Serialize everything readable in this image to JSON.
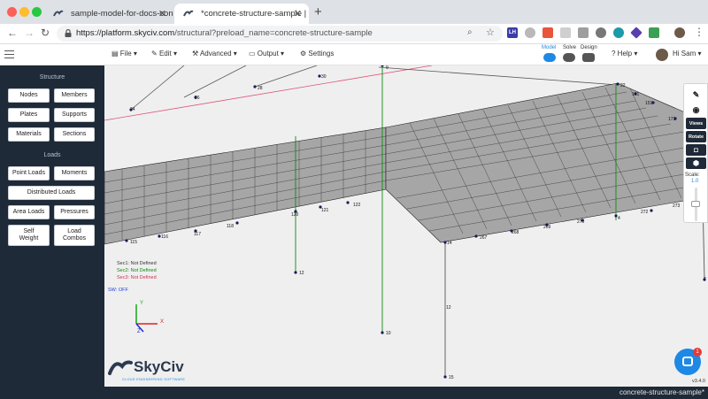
{
  "browser": {
    "tabs": [
      {
        "title": "sample-model-for-docs-concre",
        "active": false
      },
      {
        "title": "*concrete-structure-sample | Sk",
        "active": true
      }
    ],
    "url_host": "https://platform.skyciv.com",
    "url_path": "/structural?preload_name=concrete-structure-sample"
  },
  "toolbar": {
    "menus": [
      "File",
      "Edit",
      "Advanced",
      "Output",
      "Settings"
    ],
    "modes": [
      "Model",
      "Solve",
      "Design"
    ],
    "help": "Help",
    "user": "Hi Sam"
  },
  "sidebar": {
    "structure_heading": "Structure",
    "structure_buttons": [
      "Nodes",
      "Members",
      "Plates",
      "Supports",
      "Materials",
      "Sections"
    ],
    "loads_heading": "Loads",
    "load_buttons": [
      "Point Loads",
      "Moments",
      "Distributed Loads",
      "Area Loads",
      "Pressures",
      "Self Weight",
      "Load Combos"
    ]
  },
  "viewport": {
    "sections_legend": [
      {
        "label": "Sec1: Not Defined",
        "color": "#333333"
      },
      {
        "label": "Sec2: Not Defined",
        "color": "#118811"
      },
      {
        "label": "Sec3: Not Defined",
        "color": "#cc3355"
      }
    ],
    "sw_status": "SW: OFF",
    "axes": [
      "Y",
      "X",
      "Z"
    ],
    "brand": "SkyCiv",
    "brand_tagline": "CLOUD ENGINEERING SOFTWARE",
    "version": "v3.4.0",
    "scale_label": "Scale:",
    "scale_value": "1.0",
    "panel_buttons": [
      "Views",
      "Rotate"
    ],
    "chat_badge": "1",
    "node_labels": [
      {
        "id": "9"
      },
      {
        "id": "30"
      },
      {
        "id": "28"
      },
      {
        "id": "26"
      },
      {
        "id": "24"
      },
      {
        "id": "22"
      },
      {
        "id": "141"
      },
      {
        "id": "151"
      },
      {
        "id": "171"
      },
      {
        "id": "120"
      },
      {
        "id": "121"
      },
      {
        "id": "122"
      },
      {
        "id": "118"
      },
      {
        "id": "117"
      },
      {
        "id": "116"
      },
      {
        "id": "115"
      },
      {
        "id": "14"
      },
      {
        "id": "267"
      },
      {
        "id": "268"
      },
      {
        "id": "269"
      },
      {
        "id": "270"
      },
      {
        "id": "4"
      },
      {
        "id": "272"
      },
      {
        "id": "273"
      },
      {
        "id": "12"
      },
      {
        "id": "12"
      },
      {
        "id": "10"
      },
      {
        "id": "15"
      },
      {
        "id": "7"
      }
    ]
  },
  "status": {
    "file": "concrete-structure-sample*"
  },
  "colors": {
    "sidebar": "#1f2a38",
    "member_green": "#118811",
    "member_pink": "#dd5577",
    "node": "#1a1a5a",
    "accent": "#1e88e5"
  }
}
